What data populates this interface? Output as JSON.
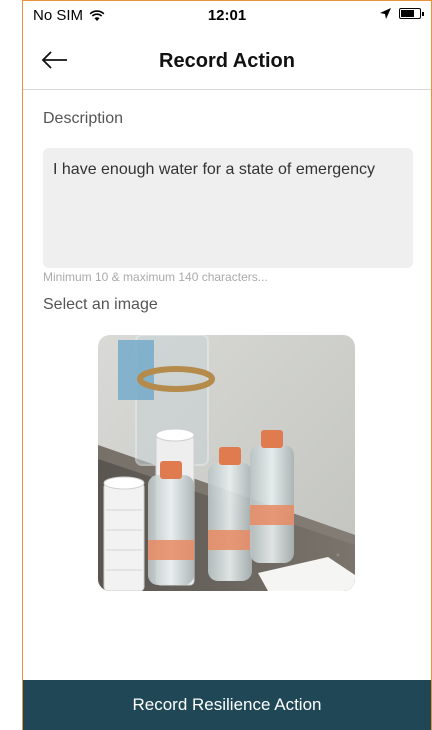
{
  "status_bar": {
    "carrier": "No SIM",
    "time": "12:01",
    "icons": [
      "wifi-icon",
      "location-arrow-icon",
      "battery-icon"
    ]
  },
  "nav": {
    "back_icon": "arrow-left-icon",
    "title": "Record Action"
  },
  "form": {
    "description_label": "Description",
    "description_value": "I have enough water for a state of emergency",
    "description_hint": "Minimum 10 & maximum 140 characters...",
    "image_label": "Select an image",
    "image_icon": "photo-water-bottles"
  },
  "footer": {
    "submit_label": "Record Resilience Action",
    "submit_color": "#1f4756"
  },
  "colors": {
    "frame_border": "#e8923b",
    "input_bg": "#efefef"
  }
}
